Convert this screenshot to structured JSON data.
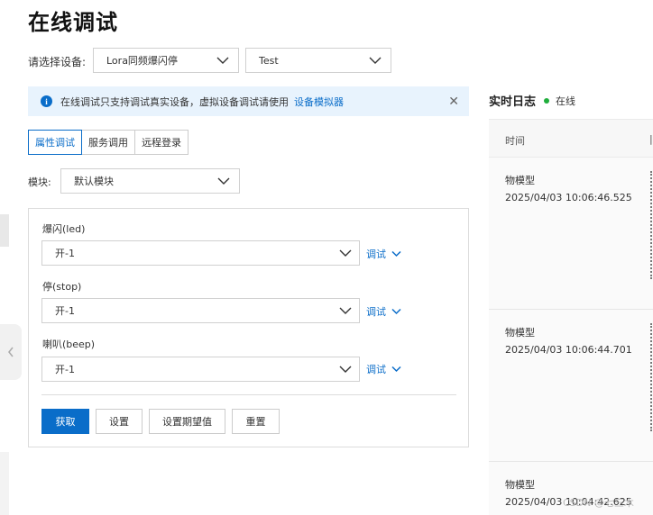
{
  "page": {
    "title": "在线调试"
  },
  "device": {
    "label": "请选择设备:",
    "product": "Lora同频爆闪停",
    "device_name": "Test"
  },
  "notice": {
    "text": "在线调试只支持调试真实设备，虚拟设备调试请使用",
    "link": "设备模拟器"
  },
  "tabs": [
    {
      "label": "属性调试",
      "active": true
    },
    {
      "label": "服务调用",
      "active": false
    },
    {
      "label": "远程登录",
      "active": false
    }
  ],
  "module": {
    "label": "模块:",
    "value": "默认模块"
  },
  "properties": [
    {
      "label": "爆闪(led)",
      "value": "开-1",
      "action": "调试"
    },
    {
      "label": "停(stop)",
      "value": "开-1",
      "action": "调试"
    },
    {
      "label": "喇叭(beep)",
      "value": "开-1",
      "action": "调试"
    }
  ],
  "buttons": {
    "get": "获取",
    "set": "设置",
    "set_expected": "设置期望值",
    "reset": "重置"
  },
  "log": {
    "title": "实时日志",
    "status": "在线",
    "status_color": "#1fae3c",
    "column_time": "时间",
    "entries": [
      {
        "type": "物模型",
        "time": "2025/04/03 10:06:46.525"
      },
      {
        "type": "物模型",
        "time": "2025/04/03 10:06:44.701"
      },
      {
        "type": "物模型",
        "time": "2025/04/03 10:04:42.625"
      }
    ]
  },
  "watermark": "CSDN @七三木",
  "colors": {
    "accent": "#0a6dc9",
    "notice_bg": "#e8f3fd"
  }
}
